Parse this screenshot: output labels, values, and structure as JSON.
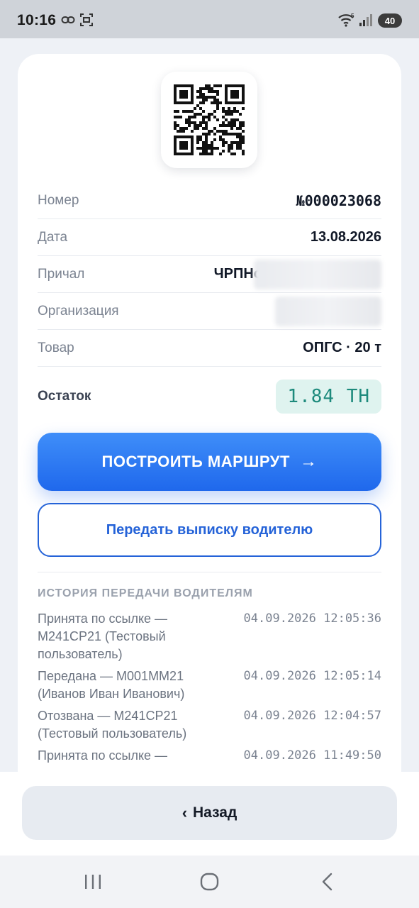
{
  "status_bar": {
    "time": "10:16",
    "battery": "40",
    "icons": [
      "link-icon",
      "screenshot-icon",
      "wifi-icon",
      "signal-icon",
      "battery-icon"
    ]
  },
  "document": {
    "fields": [
      {
        "label": "Номер",
        "value": "№000023068"
      },
      {
        "label": "Дата",
        "value": "13.08.2026"
      },
      {
        "label": "Причал",
        "value": "ЧРПНо"
      },
      {
        "label": "Организация",
        "value": ""
      },
      {
        "label": "Товар",
        "value": "ОПГС · 20 т"
      }
    ],
    "remainder_label": "Остаток",
    "remainder_value": "1.84 ТН"
  },
  "actions": {
    "route_label": "ПОСТРОИТЬ МАРШРУТ",
    "route_arrow": "→",
    "share_label": "Передать выписку водителю"
  },
  "history": {
    "title": "ИСТОРИЯ ПЕРЕДАЧИ ВОДИТЕЛЯМ",
    "items": [
      {
        "text": "Принята по ссылке — M241CP21 (Тестовый пользователь)",
        "date": "04.09.2026 12:05:36"
      },
      {
        "text": "Передана — M001MM21 (Иванов Иван Иванович)",
        "date": "04.09.2026 12:05:14"
      },
      {
        "text": "Отозвана — M241CP21 (Тестовый пользователь)",
        "date": "04.09.2026 12:04:57"
      },
      {
        "text": "Принята по ссылке —",
        "date": "04.09.2026 11:49:50"
      }
    ]
  },
  "footer": {
    "back_label": "Назад",
    "back_chevron": "‹"
  },
  "colors": {
    "accent": "#2563d8",
    "remainder_bg": "#dff3ef",
    "remainder_text": "#1d8a7c"
  }
}
